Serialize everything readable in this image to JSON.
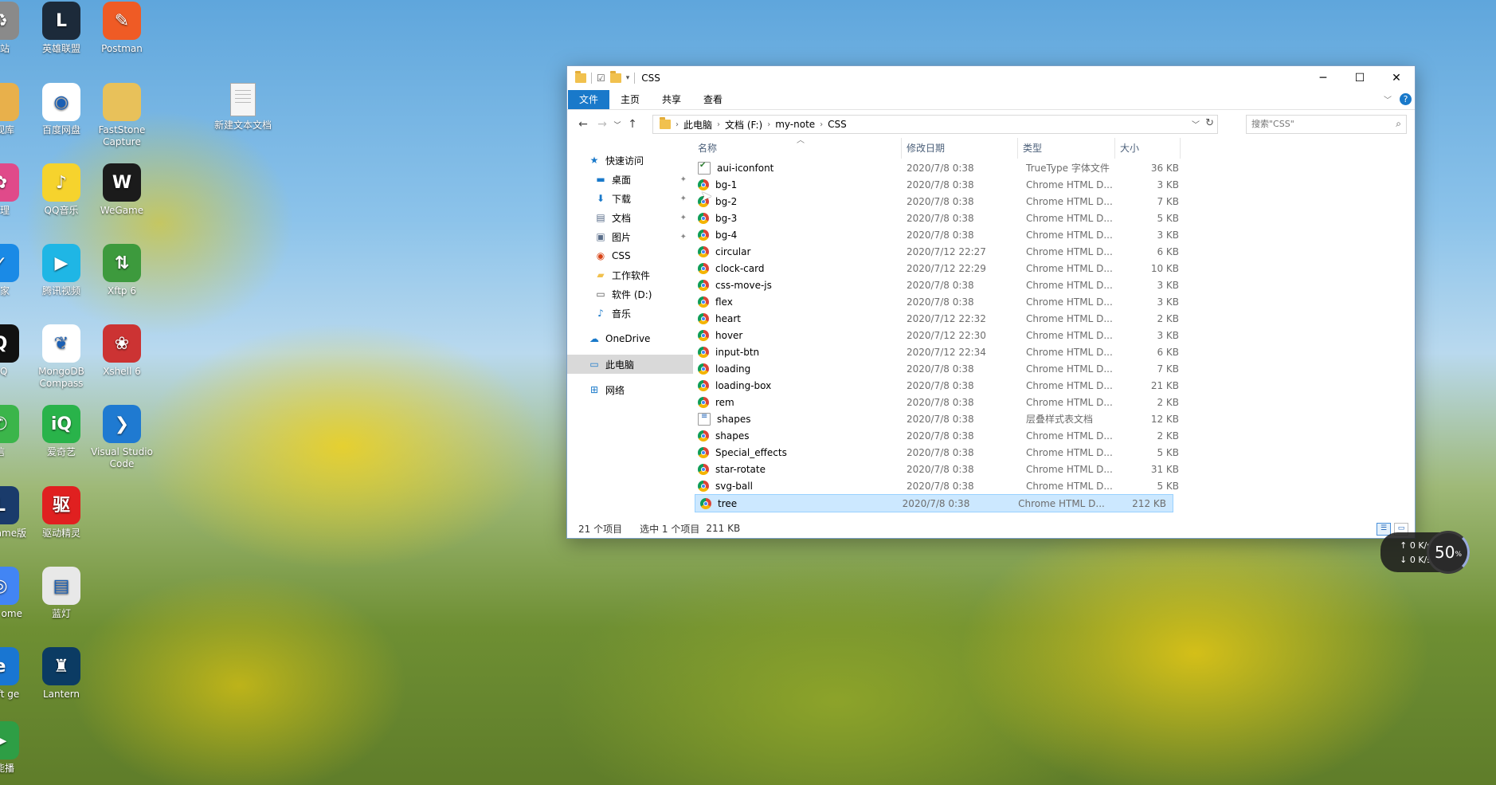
{
  "desktop": {
    "icons": [
      {
        "label": "收站",
        "icon": "recycle-bin-icon"
      },
      {
        "label": "英雄联盟",
        "icon": "lol-icon"
      },
      {
        "label": "Postman",
        "icon": "postman-icon"
      },
      {
        "label": "影视库",
        "icon": "folder-icon"
      },
      {
        "label": "百度网盘",
        "icon": "baidu-netdisk-icon"
      },
      {
        "label": "FastStone Capture",
        "icon": "faststone-icon"
      },
      {
        "label": "新建文本文档",
        "icon": "text-document-icon"
      },
      {
        "label": "管理",
        "icon": "app-icon"
      },
      {
        "label": "QQ音乐",
        "icon": "qq-music-icon"
      },
      {
        "label": "WeGame",
        "icon": "wegame-icon"
      },
      {
        "label": "管家",
        "icon": "security-shield-icon"
      },
      {
        "label": "腾讯视频",
        "icon": "tencent-video-icon"
      },
      {
        "label": "Xftp 6",
        "icon": "xftp-icon"
      },
      {
        "label": "QQ",
        "icon": "qq-icon"
      },
      {
        "label": "MongoDB Compass",
        "icon": "mongodb-icon"
      },
      {
        "label": "Xshell 6",
        "icon": "xshell-icon"
      },
      {
        "label": "信",
        "icon": "wechat-icon"
      },
      {
        "label": "爱奇艺",
        "icon": "iqiyi-icon"
      },
      {
        "label": "Visual Studio Code",
        "icon": "vscode-icon"
      },
      {
        "label": "联盟 ame版",
        "icon": "lol-wegame-icon"
      },
      {
        "label": "驱动精灵",
        "icon": "driver-genius-icon"
      },
      {
        "label": "ogle ome",
        "icon": "google-chrome-icon"
      },
      {
        "label": "蓝灯",
        "icon": "lantern-folder-icon"
      },
      {
        "label": "osoft ge",
        "icon": "edge-icon"
      },
      {
        "label": "Lantern",
        "icon": "lantern-icon"
      },
      {
        "label": "万能播",
        "icon": "player-icon"
      }
    ]
  },
  "window": {
    "title": "CSS",
    "controls": {
      "minimize": "─",
      "maximize": "☐",
      "close": "✕"
    },
    "ribbon_tabs": [
      {
        "label": "文件",
        "active": true
      },
      {
        "label": "主页",
        "active": false
      },
      {
        "label": "共享",
        "active": false
      },
      {
        "label": "查看",
        "active": false
      }
    ],
    "help": "?",
    "address": {
      "segments": [
        "此电脑",
        "文档 (F:)",
        "my-note",
        "CSS"
      ]
    },
    "search_placeholder": "搜索\"CSS\"",
    "nav_items": [
      {
        "label": "快速访问",
        "icon": "star-icon",
        "pinned": false
      },
      {
        "label": "桌面",
        "icon": "desktop-icon",
        "pinned": true
      },
      {
        "label": "下载",
        "icon": "download-icon",
        "pinned": true
      },
      {
        "label": "文档",
        "icon": "documents-icon",
        "pinned": true
      },
      {
        "label": "图片",
        "icon": "pictures-icon",
        "pinned": true
      },
      {
        "label": "CSS",
        "icon": "css-folder-icon",
        "pinned": false
      },
      {
        "label": "工作软件",
        "icon": "folder-icon",
        "pinned": false
      },
      {
        "label": "软件 (D:)",
        "icon": "drive-icon",
        "pinned": false
      },
      {
        "label": "音乐",
        "icon": "music-icon",
        "pinned": false
      },
      {
        "label": "OneDrive",
        "icon": "cloud-icon",
        "pinned": false
      },
      {
        "label": "此电脑",
        "icon": "computer-icon",
        "pinned": false
      },
      {
        "label": "网络",
        "icon": "network-icon",
        "pinned": false
      }
    ],
    "columns": {
      "name": "名称",
      "date": "修改日期",
      "type": "类型",
      "size": "大小"
    },
    "files": [
      {
        "name": "aui-iconfont",
        "date": "2020/7/8 0:38",
        "type": "TrueType 字体文件",
        "size": "36 KB",
        "kind": "font"
      },
      {
        "name": "bg-1",
        "date": "2020/7/8 0:38",
        "type": "Chrome HTML D...",
        "size": "3 KB",
        "kind": "chrome"
      },
      {
        "name": "bg-2",
        "date": "2020/7/8 0:38",
        "type": "Chrome HTML D...",
        "size": "7 KB",
        "kind": "chrome"
      },
      {
        "name": "bg-3",
        "date": "2020/7/8 0:38",
        "type": "Chrome HTML D...",
        "size": "5 KB",
        "kind": "chrome"
      },
      {
        "name": "bg-4",
        "date": "2020/7/8 0:38",
        "type": "Chrome HTML D...",
        "size": "3 KB",
        "kind": "chrome"
      },
      {
        "name": "circular",
        "date": "2020/7/12 22:27",
        "type": "Chrome HTML D...",
        "size": "6 KB",
        "kind": "chrome"
      },
      {
        "name": "clock-card",
        "date": "2020/7/12 22:29",
        "type": "Chrome HTML D...",
        "size": "10 KB",
        "kind": "chrome"
      },
      {
        "name": "css-move-js",
        "date": "2020/7/8 0:38",
        "type": "Chrome HTML D...",
        "size": "3 KB",
        "kind": "chrome"
      },
      {
        "name": "flex",
        "date": "2020/7/8 0:38",
        "type": "Chrome HTML D...",
        "size": "3 KB",
        "kind": "chrome"
      },
      {
        "name": "heart",
        "date": "2020/7/12 22:32",
        "type": "Chrome HTML D...",
        "size": "2 KB",
        "kind": "chrome"
      },
      {
        "name": "hover",
        "date": "2020/7/12 22:30",
        "type": "Chrome HTML D...",
        "size": "3 KB",
        "kind": "chrome"
      },
      {
        "name": "input-btn",
        "date": "2020/7/12 22:34",
        "type": "Chrome HTML D...",
        "size": "6 KB",
        "kind": "chrome"
      },
      {
        "name": "loading",
        "date": "2020/7/8 0:38",
        "type": "Chrome HTML D...",
        "size": "7 KB",
        "kind": "chrome"
      },
      {
        "name": "loading-box",
        "date": "2020/7/8 0:38",
        "type": "Chrome HTML D...",
        "size": "21 KB",
        "kind": "chrome"
      },
      {
        "name": "rem",
        "date": "2020/7/8 0:38",
        "type": "Chrome HTML D...",
        "size": "2 KB",
        "kind": "chrome"
      },
      {
        "name": "shapes",
        "date": "2020/7/8 0:38",
        "type": "层叠样式表文档",
        "size": "12 KB",
        "kind": "css"
      },
      {
        "name": "shapes",
        "date": "2020/7/8 0:38",
        "type": "Chrome HTML D...",
        "size": "2 KB",
        "kind": "chrome"
      },
      {
        "name": "Special_effects",
        "date": "2020/7/8 0:38",
        "type": "Chrome HTML D...",
        "size": "5 KB",
        "kind": "chrome"
      },
      {
        "name": "star-rotate",
        "date": "2020/7/8 0:38",
        "type": "Chrome HTML D...",
        "size": "31 KB",
        "kind": "chrome"
      },
      {
        "name": "svg-ball",
        "date": "2020/7/8 0:38",
        "type": "Chrome HTML D...",
        "size": "5 KB",
        "kind": "chrome"
      },
      {
        "name": "tree",
        "date": "2020/7/8 0:38",
        "type": "Chrome HTML D...",
        "size": "212 KB",
        "kind": "chrome",
        "selected": true
      }
    ],
    "status": {
      "count": "21 个项目",
      "selection": "选中 1 个项目",
      "size": "211 KB"
    }
  },
  "speed_widget": {
    "up": "0 K/s",
    "down": "0 K/s",
    "percent": "50",
    "unit": "%"
  },
  "colors": {
    "accent": "#1979ca",
    "selection": "#cce8ff"
  }
}
